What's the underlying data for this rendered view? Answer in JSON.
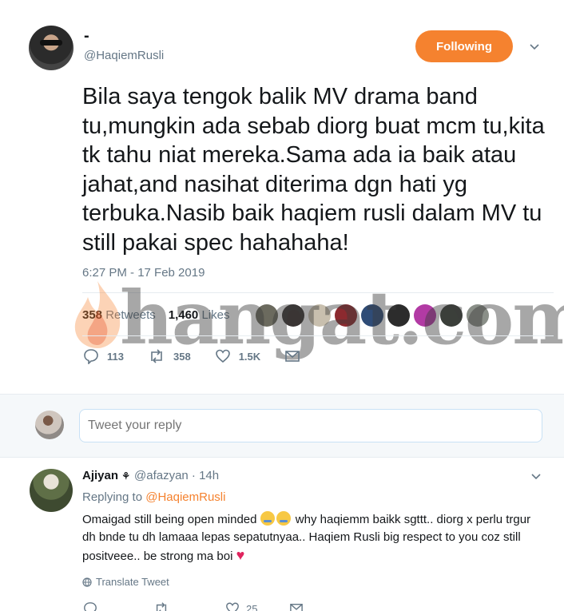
{
  "tweet": {
    "display_name": "-",
    "handle": "@HaqiemRusli",
    "follow_label": "Following",
    "text": "Bila saya tengok balik MV drama band tu,mungkin ada sebab diorg buat mcm tu,kita tk tahu niat mereka.Sama ada ia baik atau jahat,and nasihat diterima dgn hati yg terbuka.Nasib baik haqiem rusli dalam MV tu still pakai spec hahahaha!",
    "timestamp": "6:27 PM - 17 Feb 2019",
    "retweets_count": "358",
    "retweets_label": "Retweets",
    "likes_count": "1,460",
    "likes_label": "Likes",
    "replies_action": "113",
    "retweets_action": "358",
    "likes_action": "1.5K"
  },
  "watermark": "hangat.com",
  "reply_box": {
    "placeholder": "Tweet your reply"
  },
  "reply": {
    "display_name": "Ajiyan",
    "handle": "@afazyan · 14h",
    "replying_prefix": "Replying to",
    "replying_to": "@HaqiemRusli",
    "text_part1": "Omaigad still being open minded",
    "text_part2": " why haqiemm baikk sgttt.. diorg x perlu trgur dh bnde tu dh lamaaa lepas sepatutnyaa.. Haqiem Rusli big respect to you coz still positveee.. be strong ma boi",
    "translate_label": "Translate Tweet",
    "likes_action": "25"
  },
  "colors": {
    "accent": "#f5822f",
    "muted": "#657786",
    "like": "#e0245e"
  }
}
